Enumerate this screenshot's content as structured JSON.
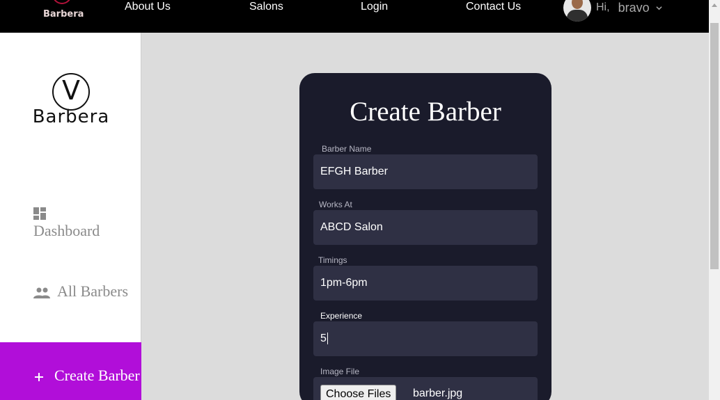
{
  "nav": {
    "logo_text": "Barbera",
    "links": [
      "About Us",
      "Salons",
      "Login",
      "Contact Us"
    ],
    "greeting": "Hi,",
    "username": "bravo"
  },
  "sidebar": {
    "logo_text": "Barbera",
    "logo_mark": "V",
    "items": [
      {
        "label": "Dashboard",
        "icon": "dashboard-icon"
      },
      {
        "label": "All Barbers",
        "icon": "people-icon"
      },
      {
        "label": "Create Barber",
        "icon": "plus-icon"
      }
    ],
    "active_color": "#b10ed9"
  },
  "form": {
    "title": "Create Barber",
    "fields": [
      {
        "label": "Barber Name",
        "value": "EFGH Barber"
      },
      {
        "label": "Works At",
        "value": "ABCD Salon"
      },
      {
        "label": "Timings",
        "value": "1pm-6pm"
      },
      {
        "label": "Experience",
        "value": "5"
      }
    ],
    "image_label": "Image File",
    "choose_button": "Choose Files",
    "file_name": "barber.jpg"
  },
  "colors": {
    "card_bg": "#1a1b2b",
    "field_bg": "#2f3044"
  }
}
